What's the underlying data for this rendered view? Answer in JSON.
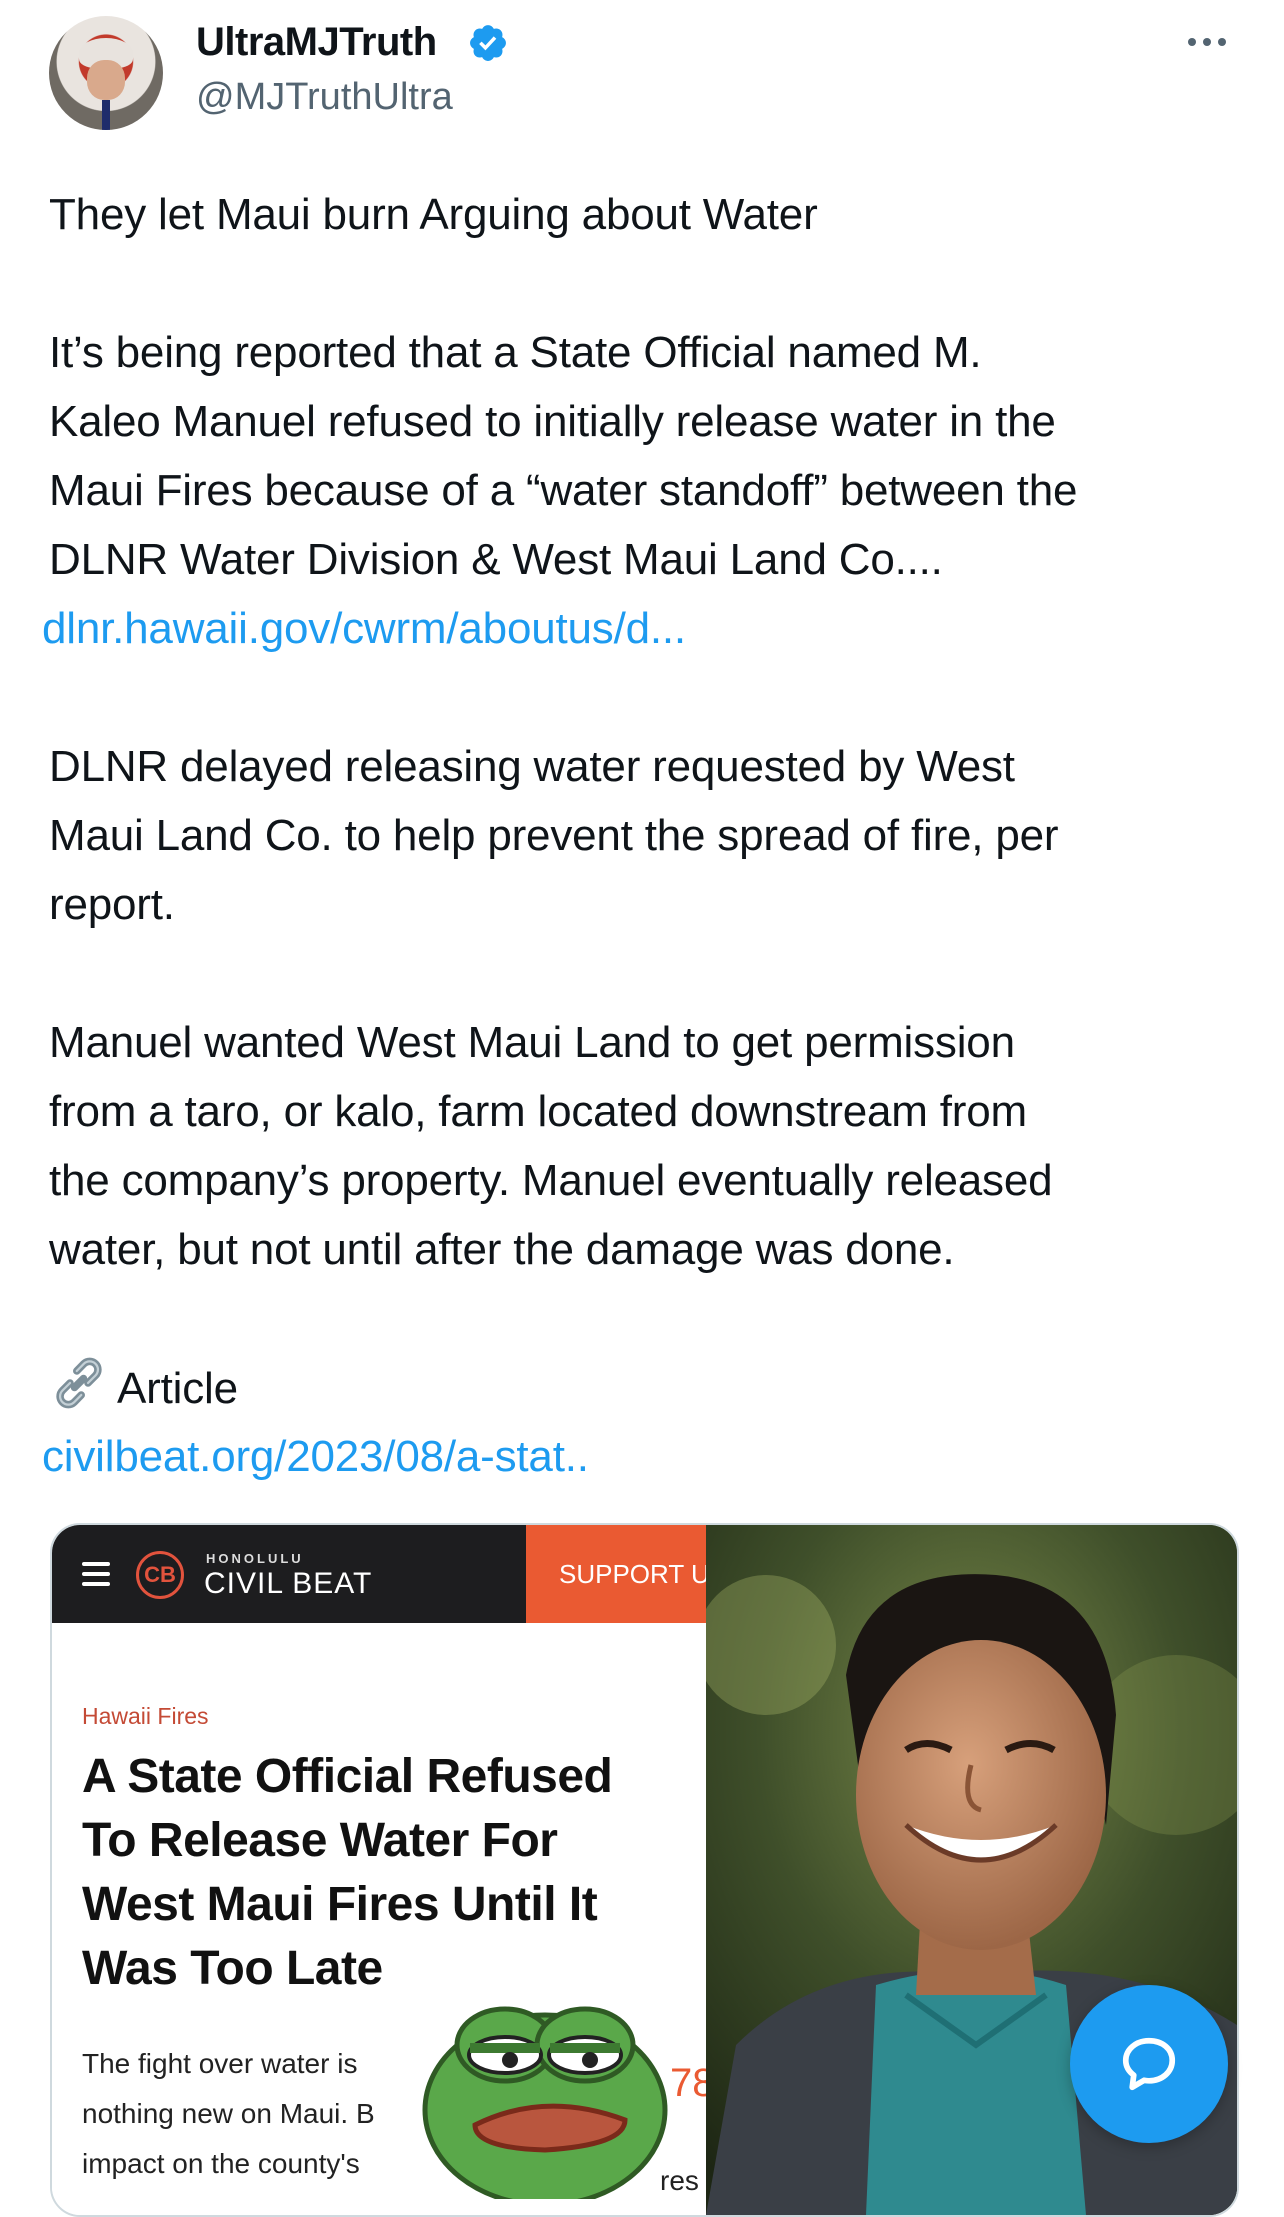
{
  "author": {
    "display_name": "UltraMJTruth",
    "handle": "@MJTruthUltra",
    "verified": true
  },
  "tweet": {
    "lines": [
      "They let Maui burn Arguing about Water",
      "",
      "It’s being reported that a State Official named M.",
      "Kaleo Manuel refused to initially release water in the",
      "Maui Fires because of a “water standoff” between the",
      "DLNR Water Division & West Maui Land Co...."
    ],
    "link1": "dlnr.hawaii.gov/cwrm/aboutus/d...",
    "para2": [
      "DLNR delayed releasing water requested by West",
      "Maui Land Co. to help prevent the spread of fire, per",
      "report."
    ],
    "para3": [
      "Manuel wanted West Maui Land to get permission",
      "from a taro, or kalo, farm located downstream from",
      "the company’s property. Manuel eventually released",
      "water, but not until after the damage was done."
    ],
    "article_label": "Article",
    "link2": "civilbeat.org/2023/08/a-stat.."
  },
  "media": {
    "site_small": "HONOLULU",
    "site_name": "CIVIL BEAT",
    "logo": "CB",
    "support": "SUPPORT US",
    "kicker": "Hawaii Fires",
    "headline_lines": [
      "A State Official Refused",
      "To Release Water For",
      "West Maui Fires Until It",
      "Was Too Late"
    ],
    "dek_lines": [
      "The fight over water is",
      "nothing new on Maui. B",
      "impact on the county's"
    ],
    "partial_number": "78",
    "partial_word": "res"
  },
  "colors": {
    "link": "#1d9bf0",
    "civil_beat_orange": "#ea5a32",
    "verified_blue": "#1d9bf0"
  }
}
